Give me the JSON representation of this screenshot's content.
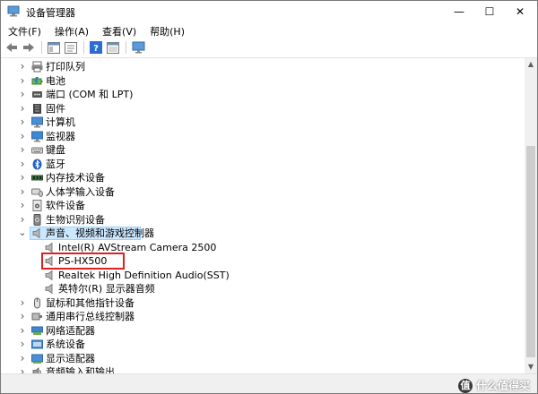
{
  "window": {
    "title": "设备管理器",
    "controls": {
      "minimize": "—",
      "maximize": "☐",
      "close": "✕"
    }
  },
  "menu": [
    "文件(F)",
    "操作(A)",
    "查看(V)",
    "帮助(H)"
  ],
  "toolbar": [
    "back-icon",
    "forward-icon",
    "show-hide-tree-icon",
    "properties-icon",
    "help-icon",
    "view-icon",
    "monitor-icon"
  ],
  "tree": {
    "categories": [
      {
        "label": "打印队列",
        "icon": "printer-queue-icon",
        "expanded": false
      },
      {
        "label": "电池",
        "icon": "battery-icon",
        "expanded": false
      },
      {
        "label": "端口 (COM 和 LPT)",
        "icon": "port-icon",
        "expanded": false
      },
      {
        "label": "固件",
        "icon": "firmware-icon",
        "expanded": false
      },
      {
        "label": "计算机",
        "icon": "computer-icon",
        "expanded": false
      },
      {
        "label": "监视器",
        "icon": "monitor-icon",
        "expanded": false
      },
      {
        "label": "键盘",
        "icon": "keyboard-icon",
        "expanded": false
      },
      {
        "label": "蓝牙",
        "icon": "bluetooth-icon",
        "expanded": false
      },
      {
        "label": "内存技术设备",
        "icon": "memory-icon",
        "expanded": false
      },
      {
        "label": "人体学输入设备",
        "icon": "hid-icon",
        "expanded": false
      },
      {
        "label": "软件设备",
        "icon": "software-device-icon",
        "expanded": false
      },
      {
        "label": "生物识别设备",
        "icon": "biometric-icon",
        "expanded": false
      },
      {
        "label": "声音、视频和游戏控制器",
        "icon": "speaker-icon",
        "expanded": true,
        "selected": true,
        "children": [
          {
            "label": "Intel(R) AVStream Camera 2500",
            "icon": "speaker-icon"
          },
          {
            "label": "PS-HX500",
            "icon": "speaker-icon",
            "highlighted": true
          },
          {
            "label": "Realtek High Definition Audio(SST)",
            "icon": "speaker-icon"
          },
          {
            "label": "英特尔(R) 显示器音频",
            "icon": "speaker-icon"
          }
        ]
      },
      {
        "label": "鼠标和其他指针设备",
        "icon": "mouse-icon",
        "expanded": false
      },
      {
        "label": "通用串行总线控制器",
        "icon": "usb-icon",
        "expanded": false
      },
      {
        "label": "网络适配器",
        "icon": "network-adapter-icon",
        "expanded": false
      },
      {
        "label": "系统设备",
        "icon": "system-device-icon",
        "expanded": false
      },
      {
        "label": "显示适配器",
        "icon": "display-adapter-icon",
        "expanded": false
      },
      {
        "label": "音频输入和输出",
        "icon": "audio-io-icon",
        "expanded": false
      }
    ]
  },
  "watermark": {
    "badge": "值",
    "text": "什么值得买"
  },
  "colors": {
    "selection": "#cce8ff",
    "highlight": "#e02020",
    "folder": "#4a90d9"
  }
}
